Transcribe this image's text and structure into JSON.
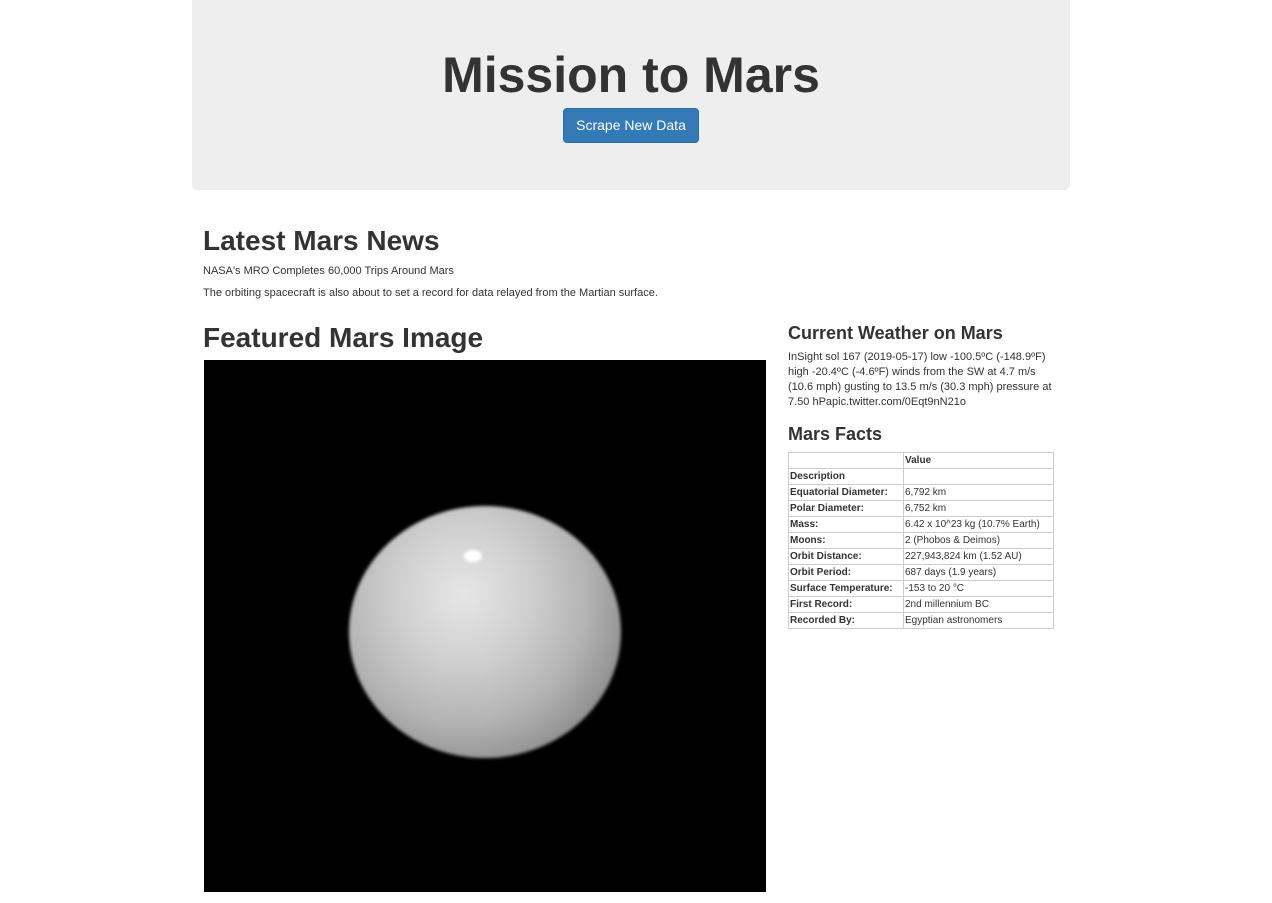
{
  "header": {
    "title": "Mission to Mars",
    "scrape_button_label": "Scrape New Data"
  },
  "news": {
    "section_title": "Latest Mars News",
    "headline": "NASA's MRO Completes 60,000 Trips Around Mars",
    "teaser": "The orbiting spacecraft is also about to set a record for data relayed from the Martian surface."
  },
  "featured_image": {
    "section_title": "Featured Mars Image"
  },
  "weather": {
    "section_title": "Current Weather on Mars",
    "report": "InSight sol 167 (2019-05-17) low -100.5ºC (-148.9ºF) high -20.4ºC (-4.6ºF) winds from the SW at 4.7 m/s (10.6 mph) gusting to 13.5 m/s (30.3 mph) pressure at 7.50 hPapic.twitter.com/0Eqt9nN21o"
  },
  "facts": {
    "section_title": "Mars Facts",
    "column_header": "Value",
    "index_label": "Description",
    "rows": [
      {
        "label": "Equatorial Diameter:",
        "value": "6,792 km"
      },
      {
        "label": "Polar Diameter:",
        "value": "6,752 km"
      },
      {
        "label": "Mass:",
        "value": "6.42 x 10^23 kg (10.7% Earth)"
      },
      {
        "label": "Moons:",
        "value": "2 (Phobos & Deimos)"
      },
      {
        "label": "Orbit Distance:",
        "value": "227,943,824 km (1.52 AU)"
      },
      {
        "label": "Orbit Period:",
        "value": "687 days (1.9 years)"
      },
      {
        "label": "Surface Temperature:",
        "value": "-153 to 20 °C"
      },
      {
        "label": "First Record:",
        "value": "2nd millennium BC"
      },
      {
        "label": "Recorded By:",
        "value": "Egyptian astronomers"
      }
    ]
  },
  "colors": {
    "button_primary": "#337ab7",
    "jumbotron_bg": "#eeeeee",
    "text": "#333333"
  }
}
